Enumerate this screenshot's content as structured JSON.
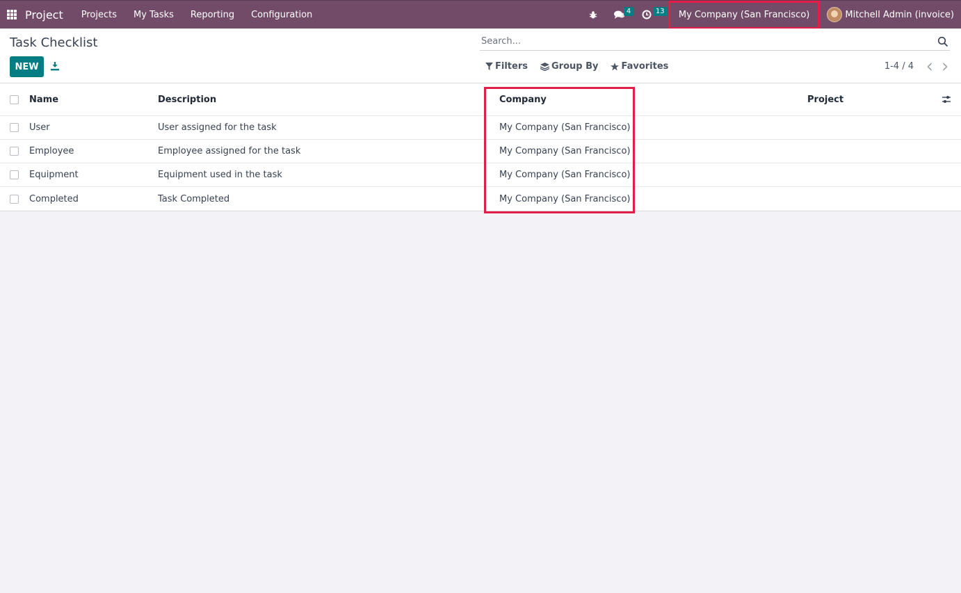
{
  "navbar": {
    "app_name": "Project",
    "menu": [
      "Projects",
      "My Tasks",
      "Reporting",
      "Configuration"
    ],
    "messages_count": "4",
    "activities_count": "13",
    "company": "My Company (San Francisco)",
    "user": "Mitchell Admin (invoice)"
  },
  "control": {
    "title": "Task Checklist",
    "new_label": "NEW",
    "search_placeholder": "Search...",
    "filters_label": "Filters",
    "groupby_label": "Group By",
    "favorites_label": "Favorites",
    "pager": "1-4 / 4"
  },
  "list": {
    "columns": {
      "name": "Name",
      "description": "Description",
      "company": "Company",
      "project": "Project"
    },
    "rows": [
      {
        "name": "User",
        "description": "User assigned for the task",
        "company": "My Company (San Francisco)",
        "project": ""
      },
      {
        "name": "Employee",
        "description": "Employee assigned for the task",
        "company": "My Company (San Francisco)",
        "project": ""
      },
      {
        "name": "Equipment",
        "description": "Equipment used in the task",
        "company": "My Company (San Francisco)",
        "project": ""
      },
      {
        "name": "Completed",
        "description": "Task Completed",
        "company": "My Company (San Francisco)",
        "project": ""
      }
    ]
  },
  "colors": {
    "navbar": "#714b67",
    "primary": "#017e84",
    "highlight": "#e11d48"
  }
}
